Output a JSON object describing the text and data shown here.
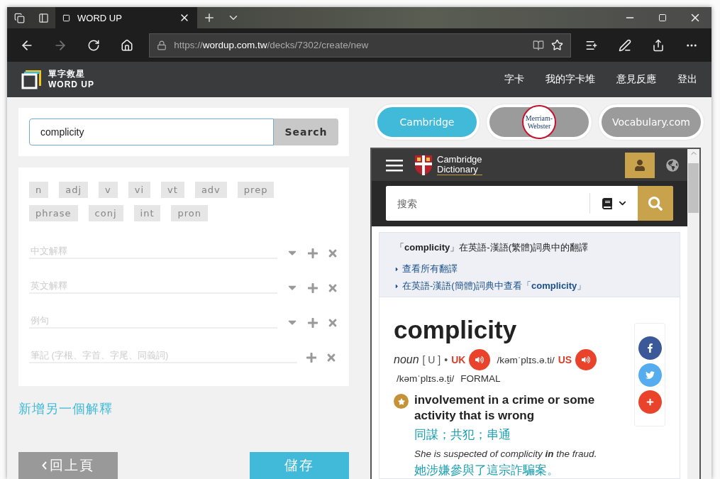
{
  "browser": {
    "tabs": [
      {
        "title": "WORD UP",
        "selected": true
      }
    ],
    "url": {
      "scheme": "https://",
      "host": "wordup.com.tw",
      "path": "/decks/7302/create/new"
    }
  },
  "site": {
    "logo": {
      "zh": "單字救星",
      "en": "WORD UP"
    },
    "nav": [
      "字卡",
      "我的字卡堆",
      "意見反應",
      "登出"
    ]
  },
  "search": {
    "value": "complicity",
    "button": "Search"
  },
  "pos_tags": [
    {
      "label": "n",
      "selected": false
    },
    {
      "label": "adj",
      "selected": false
    },
    {
      "label": "v",
      "selected": false
    },
    {
      "label": "vi",
      "selected": false
    },
    {
      "label": "vt",
      "selected": false
    },
    {
      "label": "adv",
      "selected": false
    },
    {
      "label": "prep",
      "selected": false
    },
    {
      "label": "phrase",
      "selected": false
    },
    {
      "label": "conj",
      "selected": false
    },
    {
      "label": "int",
      "selected": false
    },
    {
      "label": "pron",
      "selected": false
    }
  ],
  "fields": [
    {
      "placeholder": "中文解釋",
      "kind": "dropdown"
    },
    {
      "placeholder": "英文解釋",
      "kind": "dropdown"
    },
    {
      "placeholder": "例句",
      "kind": "dropdown"
    },
    {
      "placeholder": "筆記 (字根、字首、字尾、同義詞)",
      "kind": "plain"
    }
  ],
  "add_link": "新增另一個解釋",
  "back_button": "回上頁",
  "save_button": "儲存",
  "dictionaries": [
    {
      "label": "Cambridge",
      "kind": "text",
      "selected": true
    },
    {
      "label": "Merriam-Webster",
      "kind": "seal",
      "selected": false
    },
    {
      "label": "Vocabulary.com",
      "kind": "text",
      "selected": false
    }
  ],
  "cambridge": {
    "logo": [
      "Cambridge",
      "Dictionary"
    ],
    "search_placeholder": "搜索",
    "heading": "「**complicity**」在英語-漢語(繁體)詞典中的翻譯",
    "links": [
      "查看所有翻譯",
      "在英語-漢語(簡體)詞典中查看「**complicity**」"
    ],
    "entry": {
      "headword": "complicity",
      "pos": "noun",
      "grammar": "[ U ]",
      "separator": "•",
      "pronunciations": [
        {
          "region": "UK",
          "ipa": "/kəmˈplɪs.ə.ti/"
        },
        {
          "region": "US",
          "ipa": "/kəmˈplɪs.ə.t̬i/"
        }
      ],
      "register": "FORMAL",
      "definition": "involvement in a crime or some activity that is wrong",
      "translation": "同謀；共犯；串通",
      "example": "She is suspected of complicity **in** the fraud.",
      "example_translation": "她涉嫌參與了這宗詐騙案。"
    }
  }
}
